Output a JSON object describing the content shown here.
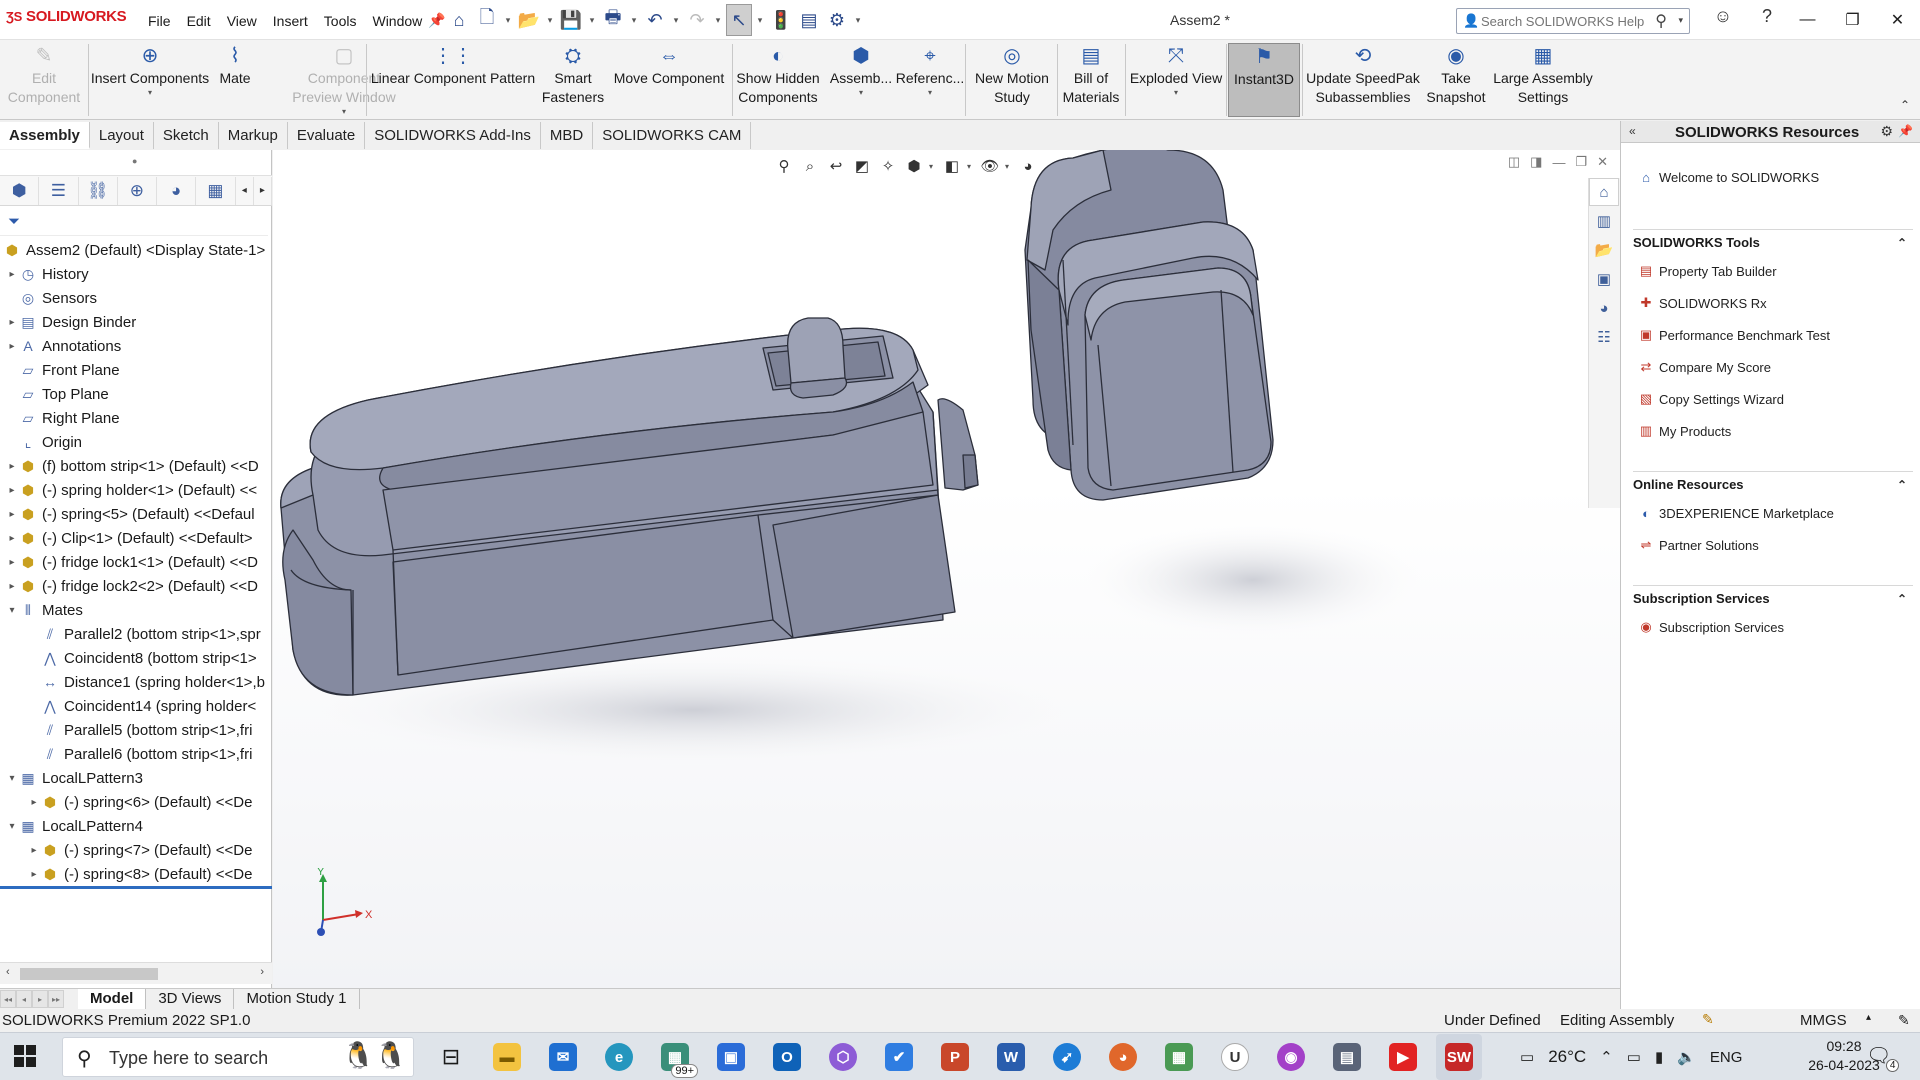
{
  "titlebar": {
    "logo": "SOLIDWORKS",
    "menus": [
      "File",
      "Edit",
      "View",
      "Insert",
      "Tools",
      "Window"
    ],
    "document_title": "Assem2 *",
    "help_search_placeholder": "Search SOLIDWORKS Help"
  },
  "command_manager": [
    {
      "label": "Edit\nComponent",
      "icon": "edit-component-icon",
      "disabled": true
    },
    {
      "label": "Insert Components",
      "icon": "insert-components-icon"
    },
    {
      "label": "Mate",
      "icon": "mate-icon"
    },
    {
      "label": "Component\nPreview Window",
      "icon": "preview-window-icon",
      "disabled": true
    },
    {
      "label": "Linear Component Pattern",
      "icon": "linear-pattern-icon"
    },
    {
      "label": "Smart\nFasteners",
      "icon": "smart-fasteners-icon"
    },
    {
      "label": "Move Component",
      "icon": "move-component-icon"
    },
    {
      "label": "Show Hidden\nComponents",
      "icon": "show-hidden-icon"
    },
    {
      "label": "Assemb...",
      "icon": "assembly-features-icon"
    },
    {
      "label": "Referenc...",
      "icon": "reference-geometry-icon"
    },
    {
      "label": "New Motion\nStudy",
      "icon": "motion-study-icon"
    },
    {
      "label": "Bill of\nMaterials",
      "icon": "bom-icon"
    },
    {
      "label": "Exploded View",
      "icon": "exploded-view-icon"
    },
    {
      "label": "Instant3D",
      "icon": "instant3d-icon",
      "active": true
    },
    {
      "label": "Update SpeedPak\nSubassemblies",
      "icon": "speedpak-icon"
    },
    {
      "label": "Take\nSnapshot",
      "icon": "snapshot-icon"
    },
    {
      "label": "Large Assembly\nSettings",
      "icon": "large-assembly-icon"
    }
  ],
  "cm_tabs": [
    "Assembly",
    "Layout",
    "Sketch",
    "Markup",
    "Evaluate",
    "SOLIDWORKS Add-Ins",
    "MBD",
    "SOLIDWORKS CAM"
  ],
  "cm_tabs_active": 0,
  "tree": [
    {
      "label": "Assem2 (Default) <Display State-1>",
      "icon": "assembly-icon",
      "level": 0,
      "arrow": ""
    },
    {
      "label": "History",
      "icon": "history-icon",
      "level": 1,
      "arrow": "▸"
    },
    {
      "label": "Sensors",
      "icon": "sensors-icon",
      "level": 1,
      "arrow": ""
    },
    {
      "label": "Design Binder",
      "icon": "design-binder-icon",
      "level": 1,
      "arrow": "▸"
    },
    {
      "label": "Annotations",
      "icon": "annotations-icon",
      "level": 1,
      "arrow": "▸"
    },
    {
      "label": "Front Plane",
      "icon": "plane-icon",
      "level": 1,
      "arrow": ""
    },
    {
      "label": "Top Plane",
      "icon": "plane-icon",
      "level": 1,
      "arrow": ""
    },
    {
      "label": "Right Plane",
      "icon": "plane-icon",
      "level": 1,
      "arrow": ""
    },
    {
      "label": "Origin",
      "icon": "origin-icon",
      "level": 1,
      "arrow": ""
    },
    {
      "label": "(f) bottom strip<1> (Default) <<D",
      "icon": "part-icon",
      "level": 1,
      "arrow": "▸"
    },
    {
      "label": "(-) spring holder<1> (Default) <<",
      "icon": "part-icon",
      "level": 1,
      "arrow": "▸"
    },
    {
      "label": "(-) spring<5> (Default) <<Defaul",
      "icon": "part-icon",
      "level": 1,
      "arrow": "▸"
    },
    {
      "label": "(-) Clip<1> (Default) <<Default>",
      "icon": "part-icon",
      "level": 1,
      "arrow": "▸"
    },
    {
      "label": "(-) fridge lock1<1> (Default) <<D",
      "icon": "part-icon",
      "level": 1,
      "arrow": "▸"
    },
    {
      "label": "(-) fridge lock2<2> (Default) <<D",
      "icon": "part-icon",
      "level": 1,
      "arrow": "▸"
    },
    {
      "label": "Mates",
      "icon": "mates-icon",
      "level": 1,
      "arrow": "▾"
    },
    {
      "label": "Parallel2 (bottom strip<1>,spr",
      "icon": "parallel-mate-icon",
      "level": 2,
      "arrow": ""
    },
    {
      "label": "Coincident8 (bottom strip<1>",
      "icon": "coincident-mate-icon",
      "level": 2,
      "arrow": ""
    },
    {
      "label": "Distance1 (spring holder<1>,b",
      "icon": "distance-mate-icon",
      "level": 2,
      "arrow": ""
    },
    {
      "label": "Coincident14 (spring holder<",
      "icon": "coincident-mate-icon",
      "level": 2,
      "arrow": ""
    },
    {
      "label": "Parallel5 (bottom strip<1>,fri",
      "icon": "parallel-mate-icon",
      "level": 2,
      "arrow": ""
    },
    {
      "label": "Parallel6 (bottom strip<1>,fri",
      "icon": "parallel-mate-icon",
      "level": 2,
      "arrow": ""
    },
    {
      "label": "LocalLPattern3",
      "icon": "pattern-icon",
      "level": 1,
      "arrow": "▾"
    },
    {
      "label": "(-) spring<6> (Default) <<De",
      "icon": "part-icon",
      "level": 2,
      "arrow": "▸"
    },
    {
      "label": "LocalLPattern4",
      "icon": "pattern-icon",
      "level": 1,
      "arrow": "▾"
    },
    {
      "label": "(-) spring<7> (Default) <<De",
      "icon": "part-icon",
      "level": 2,
      "arrow": "▸"
    },
    {
      "label": "(-) spring<8> (Default) <<De",
      "icon": "part-icon",
      "level": 2,
      "arrow": "▸"
    }
  ],
  "resources": {
    "title": "SOLIDWORKS Resources",
    "welcome": "Welcome to SOLIDWORKS",
    "sections": [
      {
        "title": "SOLIDWORKS Tools",
        "items": [
          "Property Tab Builder",
          "SOLIDWORKS Rx",
          "Performance Benchmark Test",
          "Compare My Score",
          "Copy Settings Wizard",
          "My Products"
        ]
      },
      {
        "title": "Online Resources",
        "items": [
          "3DEXPERIENCE Marketplace",
          "Partner Solutions"
        ]
      },
      {
        "title": "Subscription Services",
        "items": [
          "Subscription Services"
        ]
      }
    ]
  },
  "bottom_tabs": [
    "Model",
    "3D Views",
    "Motion Study 1"
  ],
  "bottom_tabs_active": 0,
  "status": {
    "version": "SOLIDWORKS Premium 2022 SP1.0",
    "definition": "Under Defined",
    "mode": "Editing Assembly",
    "units": "MMGS"
  },
  "triad": {
    "x": "X",
    "y": "Y"
  },
  "taskbar": {
    "search_placeholder": "Type here to search",
    "weather": "26°C",
    "language": "ENG",
    "time": "09:28",
    "date": "26-04-2023",
    "notification_count": "4",
    "mail_badge": "99+"
  },
  "colors": {
    "model_face": "#8d93a8",
    "model_dark": "#6b7186",
    "model_light": "#a9aec0",
    "brand_red": "#d71920",
    "accent_blue": "#2a5aa8"
  }
}
